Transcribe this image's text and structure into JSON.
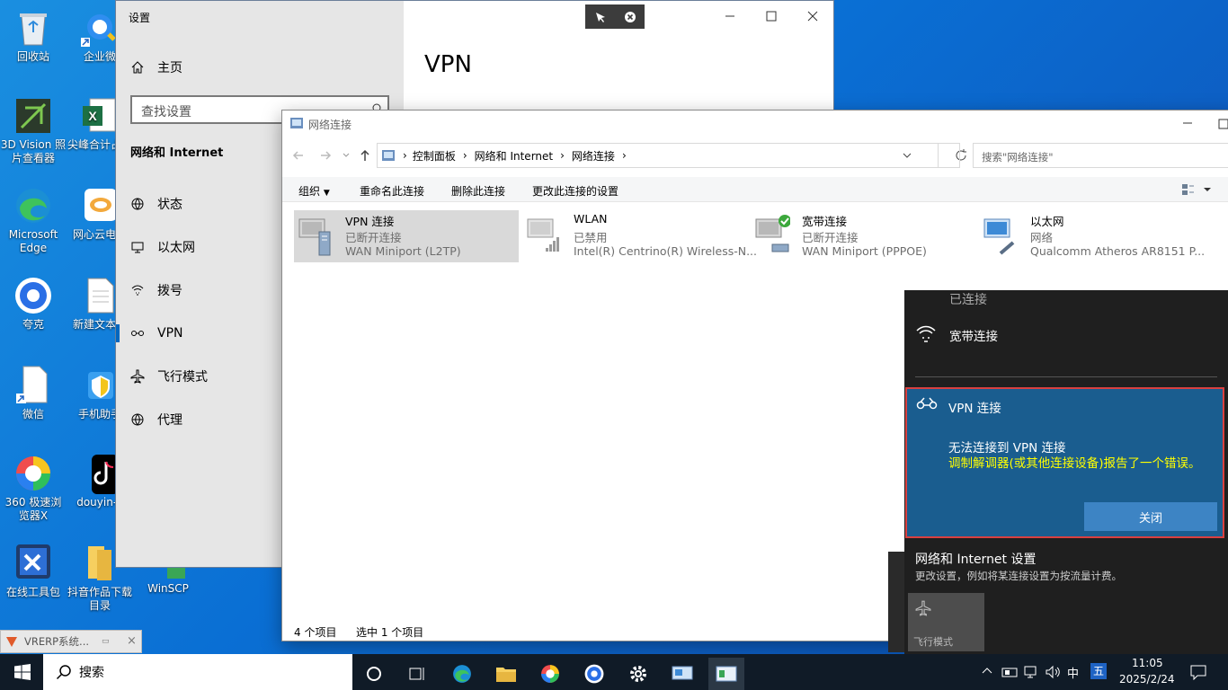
{
  "desktop": {
    "icons": [
      {
        "label": "回收站"
      },
      {
        "label": "企业微"
      },
      {
        "label": "3D Vision 照片查看器"
      },
      {
        "label": "尖峰合计占比"
      },
      {
        "label": "Microsoft Edge"
      },
      {
        "label": "网心云电宝"
      },
      {
        "label": "夸克"
      },
      {
        "label": "新建文本档"
      },
      {
        "label": "微信"
      },
      {
        "label": "手机助手"
      },
      {
        "label": "360 极速浏览器X"
      },
      {
        "label": "douyin-c"
      },
      {
        "label": "在线工具包"
      },
      {
        "label": "抖音作品下载目录"
      },
      {
        "label": "WinSCP"
      }
    ]
  },
  "settings": {
    "title": "设置",
    "home": "主页",
    "search_placeholder": "查找设置",
    "section": "网络和 Internet",
    "nav": [
      "状态",
      "以太网",
      "拨号",
      "VPN",
      "飞行模式",
      "代理"
    ],
    "page_title": "VPN"
  },
  "explorer": {
    "title": "网络连接",
    "breadcrumb": [
      "控制面板",
      "网络和 Internet",
      "网络连接"
    ],
    "search_placeholder": "搜索\"网络连接\"",
    "toolbar": {
      "organize": "组织",
      "rename": "重命名此连接",
      "delete": "删除此连接",
      "change": "更改此连接的设置"
    },
    "connections": [
      {
        "name": "VPN 连接",
        "status": "已断开连接",
        "device": "WAN Miniport (L2TP)"
      },
      {
        "name": "WLAN",
        "status": "已禁用",
        "device": "Intel(R) Centrino(R) Wireless-N..."
      },
      {
        "name": "宽带连接",
        "status": "已断开连接",
        "device": "WAN Miniport (PPPOE)"
      },
      {
        "name": "以太网",
        "status": "网络",
        "device": "Qualcomm Atheros AR8151 P..."
      }
    ],
    "status_count": "4 个项目",
    "status_selected": "选中 1 个项目"
  },
  "action_center": {
    "top_status": "已连接",
    "broadband": "宽带连接",
    "vpn_name": "VPN 连接",
    "error_title": "无法连接到 VPN 连接",
    "error_detail": "调制解调器(或其他连接设备)报告了一个错误。",
    "close_button": "关闭",
    "settings_link": "网络和 Internet 设置",
    "settings_desc": "更改设置，例如将某连接设置为按流量计费。",
    "airplane": "飞行模式"
  },
  "minimized": {
    "label": "VRERP系统..."
  },
  "taskbar": {
    "search": "搜索",
    "ime_lang": "中",
    "ime_mode": "五",
    "time": "11:05",
    "date": "2025/2/24"
  },
  "colors": {
    "accent": "#1a5d8f",
    "error_border": "#d94040",
    "error_detail_text": "#ffff00",
    "close_btn": "#3d84c4"
  }
}
